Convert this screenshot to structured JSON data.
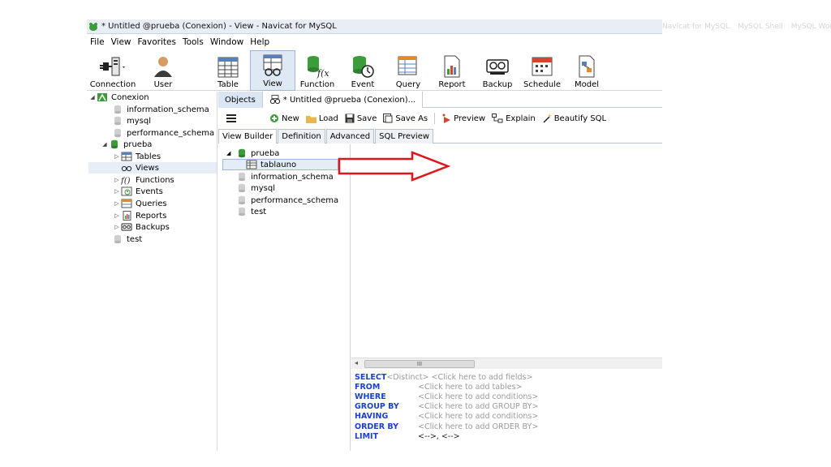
{
  "window": {
    "title": "* Untitled @prueba (Conexion) - View - Navicat for MySQL",
    "background_titles": [
      "Navicat for MySQL",
      "MySQL Shell",
      "MySQL Workbench"
    ]
  },
  "menu": [
    "File",
    "View",
    "Favorites",
    "Tools",
    "Window",
    "Help"
  ],
  "toolbar": {
    "buttons": [
      "Connection",
      "User",
      "Table",
      "View",
      "Function",
      "Event",
      "Query",
      "Report",
      "Backup",
      "Schedule",
      "Model"
    ],
    "active": "View"
  },
  "nav": {
    "connection": "Conexion",
    "databases": [
      "information_schema",
      "mysql",
      "performance_schema",
      "prueba",
      "test"
    ],
    "prueba_children": [
      "Tables",
      "Views",
      "Functions",
      "Events",
      "Queries",
      "Reports",
      "Backups"
    ],
    "selected": "Views"
  },
  "editor": {
    "tabs": {
      "objects": "Objects",
      "document": "* Untitled @prueba (Conexion)..."
    },
    "actions": {
      "new": "New",
      "load": "Load",
      "save": "Save",
      "save_as": "Save As",
      "preview": "Preview",
      "explain": "Explain",
      "beautify": "Beautify SQL"
    },
    "view_tabs": [
      "View Builder",
      "Definition",
      "Advanced",
      "SQL Preview"
    ],
    "active_view_tab": "View Builder",
    "tree": {
      "db": "prueba",
      "table": "tablauno",
      "others": [
        "information_schema",
        "mysql",
        "performance_schema",
        "test"
      ]
    },
    "scroll_thumb": "III",
    "sql": {
      "select": "SELECT",
      "distinct": "<Distinct>",
      "select_ph": "<Click here to add fields>",
      "from": "FROM",
      "from_ph": "<Click here to add tables>",
      "where": "WHERE",
      "where_ph": "<Click here to add conditions>",
      "group": "GROUP BY",
      "group_ph": "<Click here to add GROUP BY>",
      "having": "HAVING",
      "having_ph": "<Click here to add conditions>",
      "order": "ORDER BY",
      "order_ph": "<Click here to add ORDER BY>",
      "limit": "LIMIT",
      "limit_val": "<-->, <-->"
    }
  },
  "colors": {
    "annotation_arrow": "#e0161a",
    "sql_keyword": "#1a3fd1",
    "placeholder": "#9a9a9a"
  }
}
